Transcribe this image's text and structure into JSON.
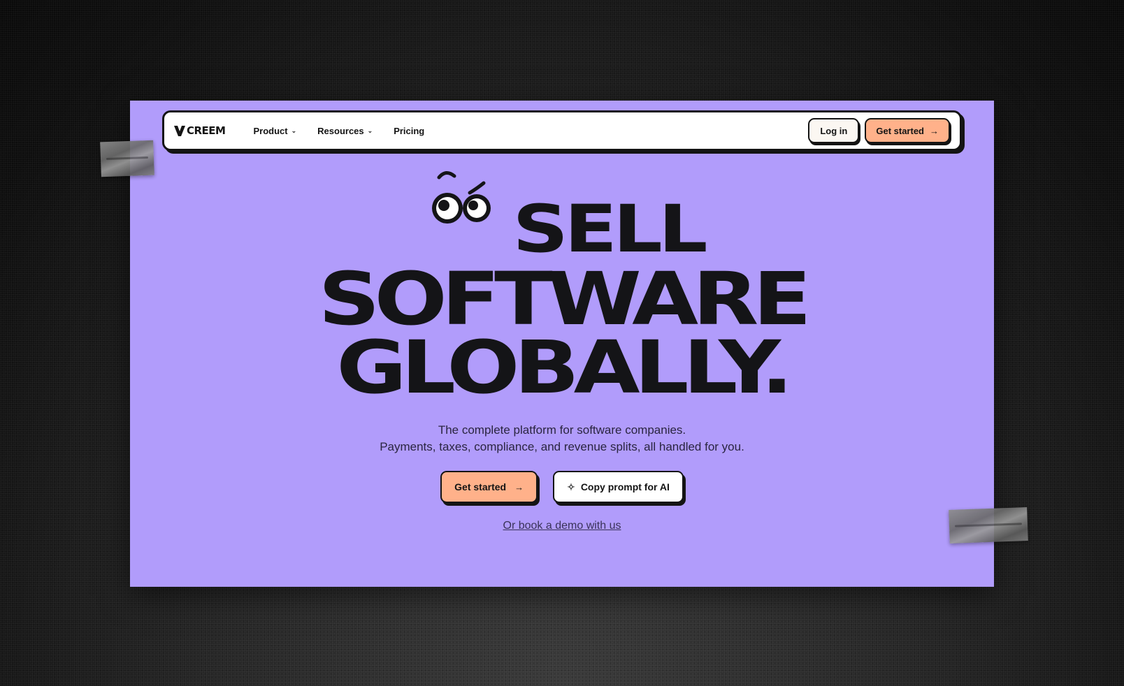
{
  "brand": {
    "name": "CREEM"
  },
  "nav": {
    "items": [
      {
        "label": "Product",
        "has_dropdown": true
      },
      {
        "label": "Resources",
        "has_dropdown": true
      },
      {
        "label": "Pricing",
        "has_dropdown": false
      }
    ],
    "login_label": "Log in",
    "get_started_label": "Get started"
  },
  "hero": {
    "line1": "SELL",
    "line2": "SOFTWARE",
    "line3": "GLOBALLY.",
    "subtitle_1": "The complete platform for software companies.",
    "subtitle_2": "Payments, taxes, compliance, and revenue splits, all handled for you.",
    "cta_primary": "Get started",
    "cta_secondary": "Copy prompt for AI",
    "demo_link": "Or book a demo with us"
  },
  "icons": {
    "arrow": "arrow-right-icon",
    "chevron": "chevron-down-icon",
    "sparkle": "sparkle-icon"
  },
  "colors": {
    "background": "#b19cfb",
    "accent": "#ffb18a",
    "ink": "#141414"
  }
}
